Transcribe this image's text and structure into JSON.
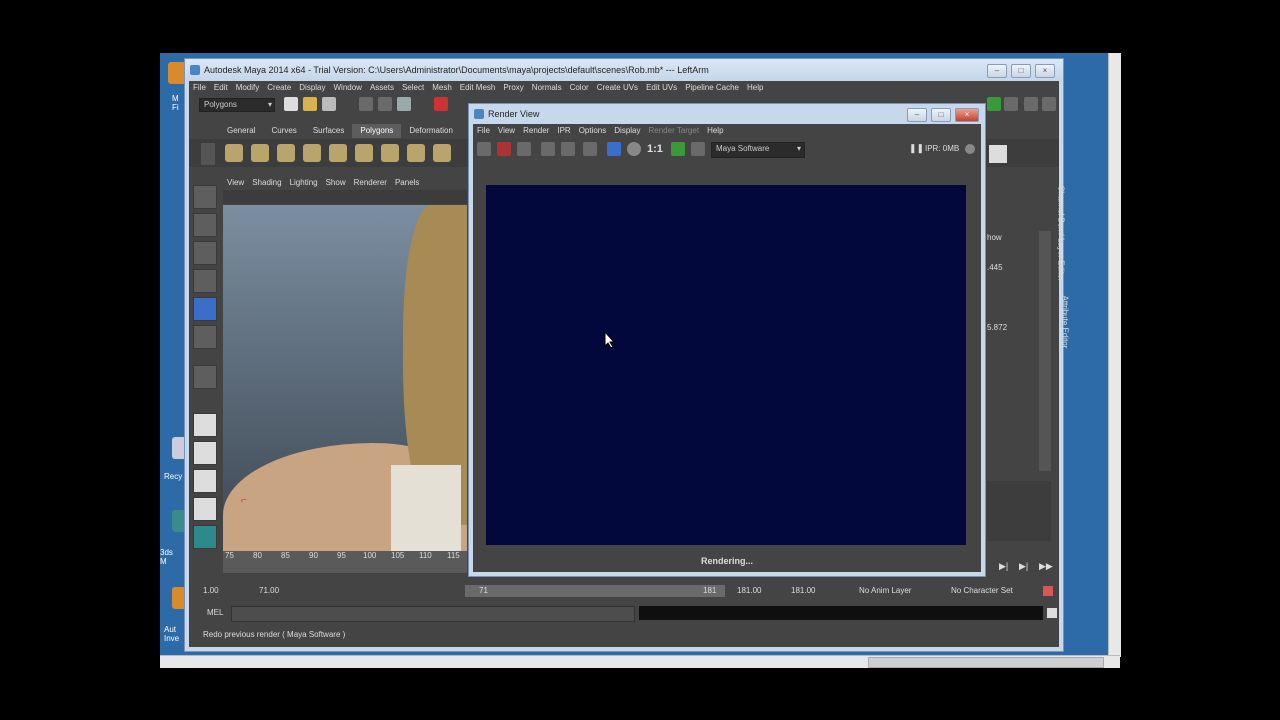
{
  "desktop": {
    "icons": [
      {
        "label": "M Fi"
      },
      {
        "label": "Recy"
      },
      {
        "label": "3ds M"
      },
      {
        "label": "Aut Inve"
      }
    ]
  },
  "maya": {
    "title": "Autodesk Maya 2014 x64 - Trial Version: C:\\Users\\Administrator\\Documents\\maya\\projects\\default\\scenes\\Rob.mb*   ---   LeftArm",
    "menus": [
      "File",
      "Edit",
      "Modify",
      "Create",
      "Display",
      "Window",
      "Assets",
      "Select",
      "Mesh",
      "Edit Mesh",
      "Proxy",
      "Normals",
      "Color",
      "Create UVs",
      "Edit UVs",
      "Pipeline Cache",
      "Help"
    ],
    "mode_select": "Polygons",
    "shelf_tabs": [
      "General",
      "Curves",
      "Surfaces",
      "Polygons",
      "Deformation"
    ],
    "active_shelf": "Polygons",
    "panel_menus": [
      "View",
      "Shading",
      "Lighting",
      "Show",
      "Renderer",
      "Panels"
    ],
    "timeline_ticks": [
      "75",
      "80",
      "85",
      "90",
      "95",
      "100",
      "105",
      "110",
      "115"
    ],
    "range": {
      "start": "1.00",
      "inner_start": "71.00",
      "slider_start": "71",
      "slider_end": "181",
      "inner_end": "181.00",
      "end": "181.00"
    },
    "anim_layer": "No Anim Layer",
    "char_set": "No Character Set",
    "cmd_label": "MEL",
    "help_line": "Redo previous render ( Maya Software )",
    "channel_values": [
      ".445",
      "5.872"
    ],
    "channel_show": "how",
    "side_tabs": [
      "Channel Box / Layer Editor",
      "Attribute Editor"
    ]
  },
  "render_view": {
    "title": "Render View",
    "menus": [
      "File",
      "View",
      "Render",
      "IPR",
      "Options",
      "Display"
    ],
    "disabled_menu": "Render Target",
    "help_menu": "Help",
    "ratio": "1:1",
    "renderer": "Maya Software",
    "ipr_label": "IPR: 0MB",
    "status": "Rendering...",
    "canvas_color": "#02073c"
  }
}
